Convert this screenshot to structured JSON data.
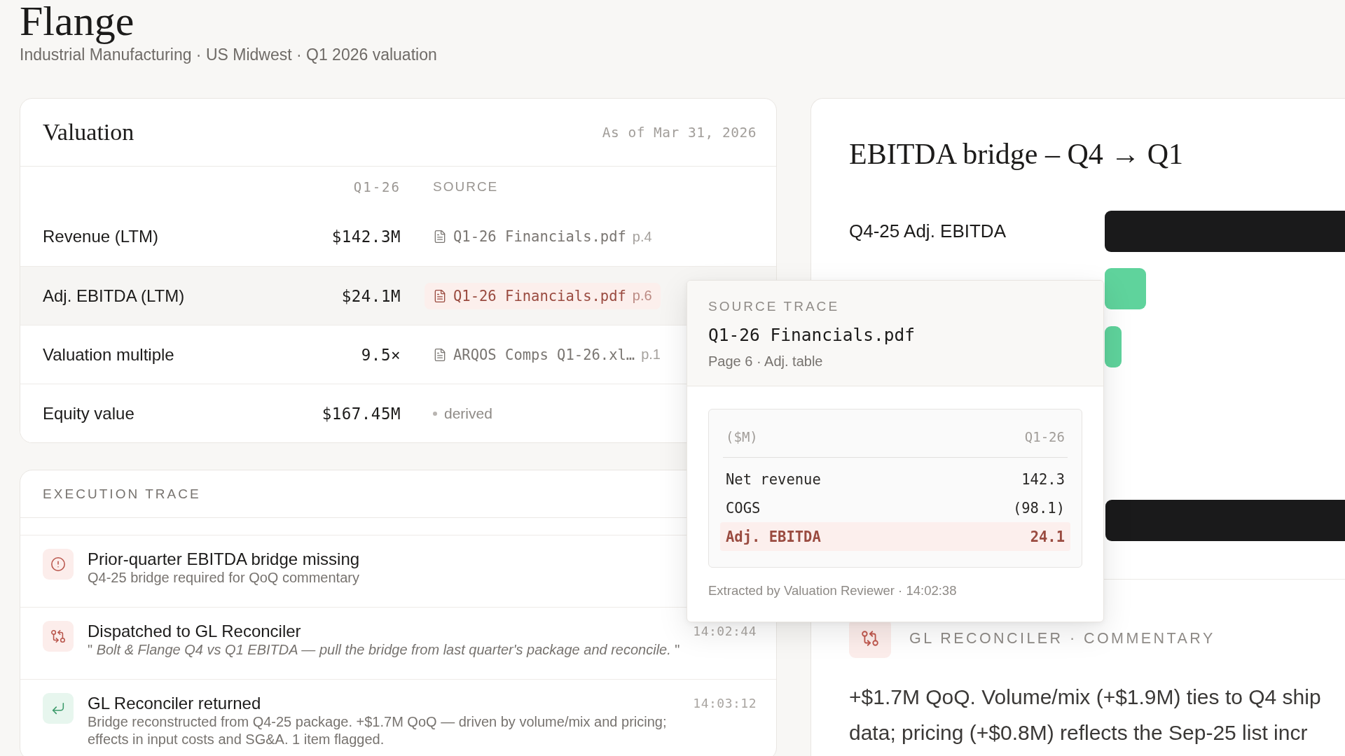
{
  "header": {
    "title": "Flange",
    "subtitle": "Industrial Manufacturing · US Midwest · Q1 2026 valuation"
  },
  "valuation": {
    "title": "Valuation",
    "as_of": "As of Mar 31, 2026",
    "columns": [
      "Q1-26",
      "SOURCE"
    ],
    "rows": [
      {
        "label": "Revenue (LTM)",
        "value": "$142.3M",
        "selected": false,
        "source": {
          "kind": "file",
          "name": "Q1-26 Financials.pdf",
          "page": "p.4"
        }
      },
      {
        "label": "Adj. EBITDA (LTM)",
        "value": "$24.1M",
        "selected": true,
        "source": {
          "kind": "file",
          "name": "Q1-26 Financials.pdf",
          "page": "p.6"
        }
      },
      {
        "label": "Valuation multiple",
        "value": "9.5×",
        "selected": false,
        "source": {
          "kind": "file",
          "name": "ARQOS Comps Q1-26.xl…",
          "page": "p.1"
        }
      },
      {
        "label": "Equity value",
        "value": "$167.45M",
        "selected": false,
        "source": {
          "kind": "derived",
          "name": "derived"
        }
      }
    ]
  },
  "execution_trace": {
    "title": "EXECUTION TRACE",
    "events": [
      {
        "kind": "alert",
        "title": "Prior-quarter EBITDA bridge missing",
        "detail": "Q4-25 bridge required for QoQ commentary"
      },
      {
        "kind": "dispatch",
        "title": "Dispatched to GL Reconciler",
        "time": "14:02:44",
        "detail": "\" *Bolt & Flange Q4 vs Q1 EBITDA — pull the bridge from last quarter's package and reconcile.* \""
      },
      {
        "kind": "return",
        "title": "GL Reconciler returned",
        "time": "14:03:12",
        "detail": "Bridge reconstructed from Q4-25 package. +$1.7M QoQ — driven by volume/mix and pricing; effects in input costs and SG&A. 1 item flagged."
      }
    ]
  },
  "bridge": {
    "title": "EBITDA bridge – Q4 → Q1",
    "first_bar_label": "Q4-25 Adj. EBITDA",
    "commentary": {
      "heading": "GL RECONCILER · COMMENTARY",
      "lines": [
        "+$1.7M QoQ. Volume/mix (+$1.9M) ties to Q4 ship",
        "data; pricing (+$0.8M) reflects the Sep-25 list incr"
      ]
    }
  },
  "source_trace": {
    "label": "SOURCE TRACE",
    "file": "Q1-26 Financials.pdf",
    "location": "Page 6 · Adj. table",
    "table": {
      "columns": [
        "($M)",
        "Q1-26"
      ],
      "rows": [
        {
          "label": "Net revenue",
          "value": "142.3",
          "selected": false
        },
        {
          "label": "COGS",
          "value": "(98.1)",
          "selected": false
        },
        {
          "label": "Adj. EBITDA",
          "value": "24.1",
          "selected": true
        }
      ]
    },
    "footer": "Extracted by Valuation Reviewer · 14:02:38"
  }
}
